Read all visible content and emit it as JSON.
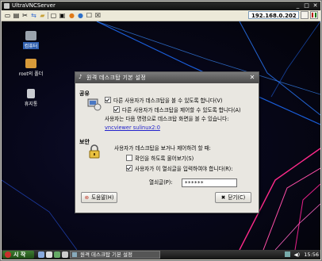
{
  "window": {
    "title": "UltraVNCServer"
  },
  "toolbar": {
    "host": "192.168.0.202",
    "icons": [
      "new-icon",
      "open-icon",
      "tools-icon",
      "transfer-icon",
      "folder-icon",
      "chat-icon",
      "info-icon",
      "stop-icon",
      "fullscreen-icon",
      "close-icon",
      "help-icon"
    ]
  },
  "desktop": {
    "icons": [
      {
        "label": "컴퓨터",
        "icon": "computer-icon"
      },
      {
        "label": "root의 폴더",
        "icon": "home-folder-icon"
      },
      {
        "label": "휴지통",
        "icon": "trash-icon"
      }
    ]
  },
  "dialog": {
    "title": "원격 데스크탑 기본 설정",
    "sharing": {
      "heading": "공유",
      "allow_view": "다른 사용자가 데스크탑을 볼 수 있도록 합니다(V)",
      "allow_control": "다른 사용자가 데스크탑을 제어할 수 있도록 합니다(A)",
      "hint": "사용자는 다음 명령으로 데스크탑 화면을 볼 수 있습니다:",
      "command": "vncviewer sulinux2:0"
    },
    "security": {
      "heading": "보안",
      "intro": "사용자가 데스크탑을 보거나 제어하려 할 때:",
      "ask_confirm": "확인을 하도록 물어보기(S)",
      "require_password": "사용자가 이 열쇠글을 입력하여야 합니다(R):",
      "password_label": "열쇠글(P):",
      "password_value": "******"
    },
    "help_button": "도움말(H)",
    "close_button": "닫기(C)",
    "checks": {
      "allow_view": true,
      "allow_control": true,
      "ask_confirm": false,
      "require_password": true
    }
  },
  "taskbar": {
    "start_label": "시 작",
    "task_label": "원격 데스크탑 기본 설정",
    "clock": "15:56"
  }
}
